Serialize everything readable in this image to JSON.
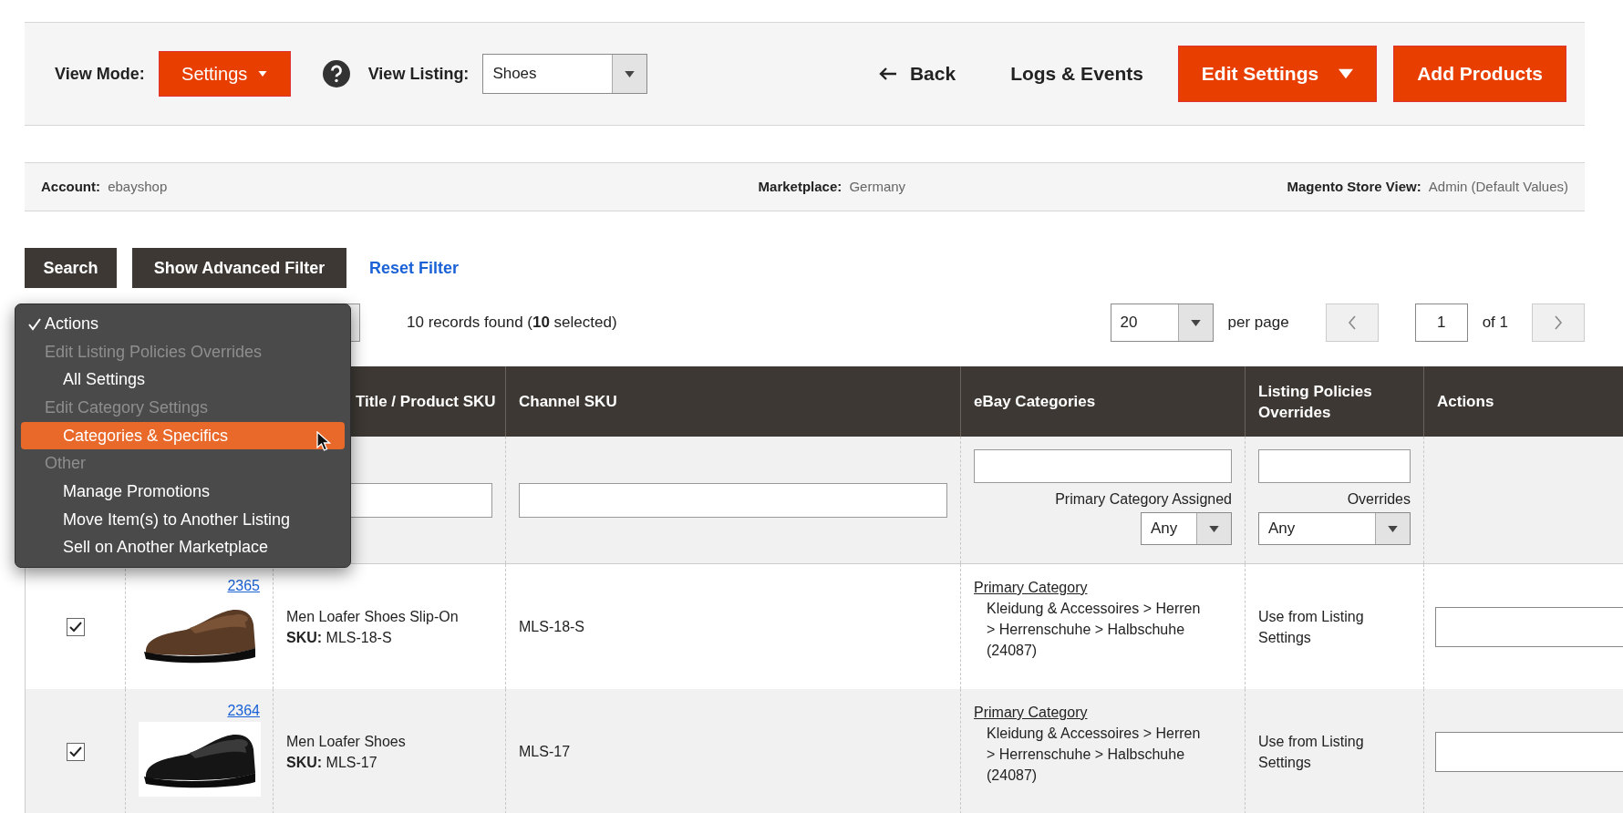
{
  "top_bar": {
    "view_mode_label": "View Mode:",
    "view_mode": "Settings",
    "view_listing_label": "View Listing:",
    "view_listing": "Shoes",
    "back": "Back",
    "logs": "Logs & Events",
    "edit_settings": "Edit Settings",
    "add_products": "Add Products"
  },
  "info_bar": [
    {
      "label": "Account:",
      "value": "ebayshop"
    },
    {
      "label": "Marketplace:",
      "value": "Germany"
    },
    {
      "label": "Magento Store View:",
      "value": "Admin (Default Values)"
    }
  ],
  "filter_buttons": {
    "search": "Search",
    "advanced": "Show Advanced Filter",
    "reset": "Reset Filter"
  },
  "records": "10 records found (**10** selected)",
  "pagination": {
    "per_page_value": "20",
    "per_page_label": "per page",
    "page": "1",
    "of": "of 1"
  },
  "action_menu": [
    {
      "kind": "placeholder",
      "label": "Actions",
      "checked": true,
      "selected": false
    },
    {
      "kind": "group",
      "label": "Edit Listing Policies Overrides"
    },
    {
      "kind": "option",
      "label": "All Settings",
      "checked": false,
      "selected": false
    },
    {
      "kind": "group",
      "label": "Edit Category Settings"
    },
    {
      "kind": "option",
      "label": "Categories & Specifics",
      "checked": false,
      "selected": true
    },
    {
      "kind": "group",
      "label": "Other"
    },
    {
      "kind": "option",
      "label": "Manage Promotions",
      "checked": false,
      "selected": false
    },
    {
      "kind": "option",
      "label": "Move Item(s) to Another Listing",
      "checked": false,
      "selected": false
    },
    {
      "kind": "option",
      "label": "Sell on Another Marketplace",
      "checked": false,
      "selected": false
    }
  ],
  "table": {
    "columns": [
      {
        "label": "Title / Product SKU"
      },
      {
        "label": "Channel SKU"
      },
      {
        "label": "eBay Categories"
      },
      {
        "label": "Listing Policies Overrides"
      },
      {
        "label": "Actions"
      }
    ],
    "filters": {
      "category_label": "Primary Category Assigned",
      "category_select": "Any",
      "overrides_label": "Overrides",
      "overrides_select": "Any"
    },
    "rows": [
      {
        "checked": true,
        "id": "2365",
        "title": "Men Loafer Shoes Slip-On",
        "sku_label": "SKU:",
        "sku": "MLS-18-S",
        "channel_sku": "MLS-18-S",
        "category_label": "Primary Category",
        "category_path": "Kleidung & Accessoires > Herren > Herrenschuhe > Halbschuhe (24087)",
        "overrides": "Use from Listing Settings"
      },
      {
        "checked": true,
        "id": "2364",
        "title": "Men Loafer Shoes",
        "sku_label": "SKU:",
        "sku": "MLS-17",
        "channel_sku": "MLS-17",
        "category_label": "Primary Category",
        "category_path": "Kleidung & Accessoires > Herren > Herrenschuhe > Halbschuhe (24087)",
        "overrides": "Use from Listing Settings"
      }
    ]
  }
}
